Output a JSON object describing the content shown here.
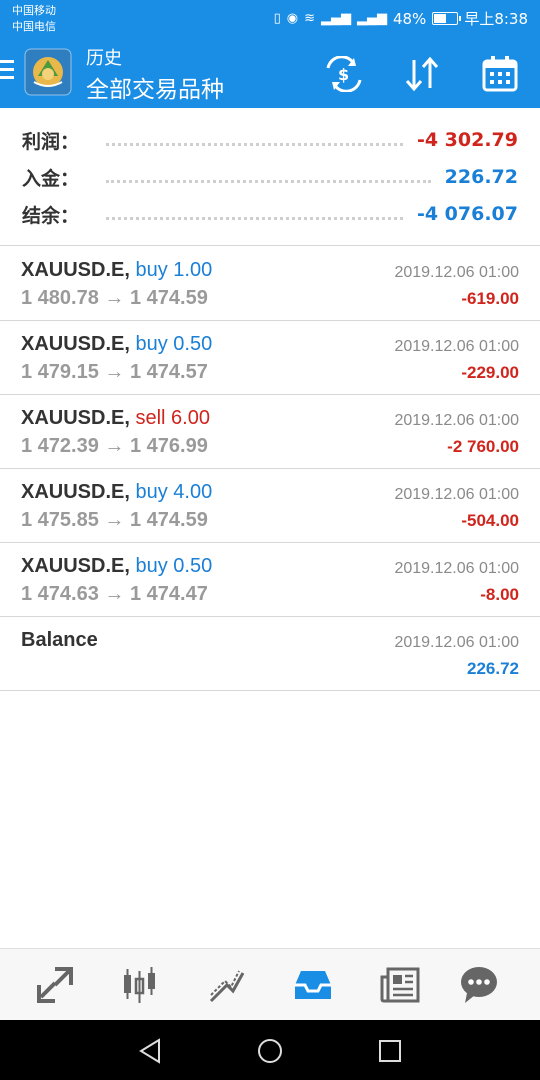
{
  "status": {
    "carrier1": "中国移动",
    "carrier2": "中国电信",
    "battery": "48%",
    "time": "早上8:38"
  },
  "header": {
    "small_title": "历史",
    "main_title": "全部交易品种"
  },
  "summary": {
    "profit_label": "利润：",
    "profit_value": "-4 302.79",
    "deposit_label": "入金：",
    "deposit_value": "226.72",
    "balance_label": "结余：",
    "balance_value": "-4 076.07"
  },
  "trades": [
    {
      "symbol": "XAUUSD.E,",
      "side": "buy 1.00",
      "prices": "1 480.78 → 1 474.59",
      "time": "2019.12.06 01:00",
      "profit": "-619.00"
    },
    {
      "symbol": "XAUUSD.E,",
      "side": "buy 0.50",
      "prices": "1 479.15 → 1 474.57",
      "time": "2019.12.06 01:00",
      "profit": "-229.00"
    },
    {
      "symbol": "XAUUSD.E,",
      "side": "sell 6.00",
      "prices": "1 472.39 → 1 476.99",
      "time": "2019.12.06 01:00",
      "profit": "-2 760.00"
    },
    {
      "symbol": "XAUUSD.E,",
      "side": "buy 4.00",
      "prices": "1 475.85 → 1 474.59",
      "time": "2019.12.06 01:00",
      "profit": "-504.00"
    },
    {
      "symbol": "XAUUSD.E,",
      "side": "buy 0.50",
      "prices": "1 474.63 → 1 474.47",
      "time": "2019.12.06 01:00",
      "profit": "-8.00"
    }
  ],
  "balance_row": {
    "label": "Balance",
    "time": "2019.12.06 01:00",
    "amount": "226.72"
  },
  "colors": {
    "accent": "#1a8de5",
    "loss": "#d0251d",
    "gain": "#1a7fd6",
    "sell": "#d0251d",
    "buy": "#1a7fd6"
  }
}
